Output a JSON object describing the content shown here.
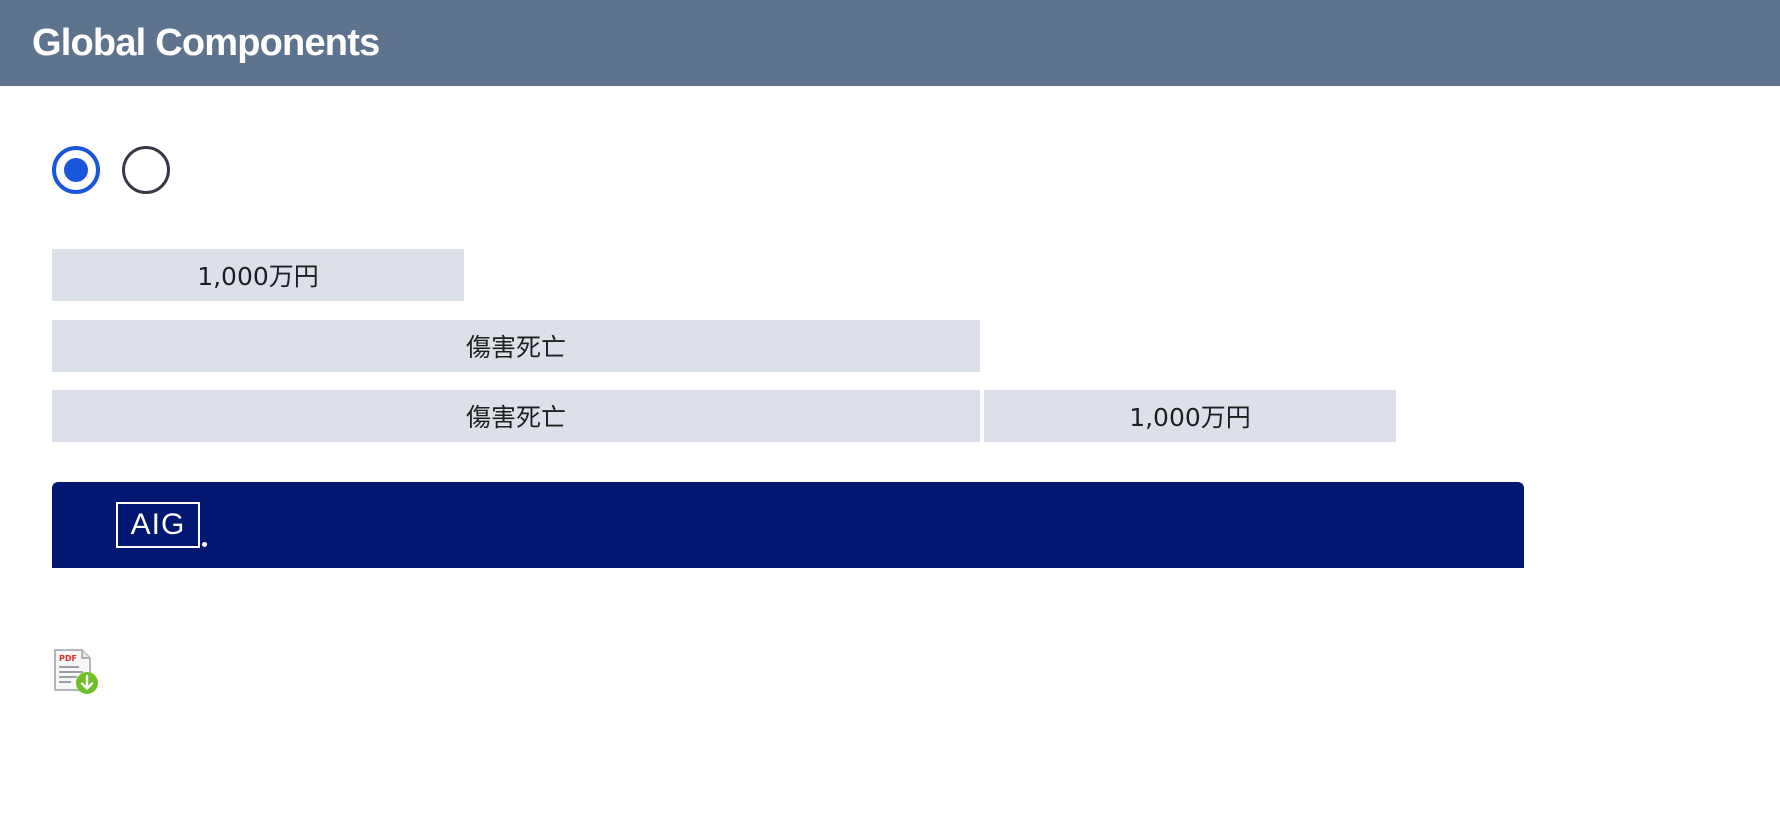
{
  "header": {
    "title": "Global Components"
  },
  "radios": [
    {
      "state": "checked"
    },
    {
      "state": "unchecked"
    }
  ],
  "coverage": {
    "amount": "1,000万円",
    "label": "傷害死亡",
    "row_label": "傷害死亡",
    "row_amount": "1,000万円"
  },
  "banner": {
    "logo_text": "AIG",
    "background_color": "#001871"
  },
  "download": {
    "icon": "pdf-download-icon",
    "badge_text": "PDF"
  },
  "colors": {
    "header": "#5e748e",
    "radio_accent": "#1a56db",
    "cell_bg": "#dce1e9"
  }
}
